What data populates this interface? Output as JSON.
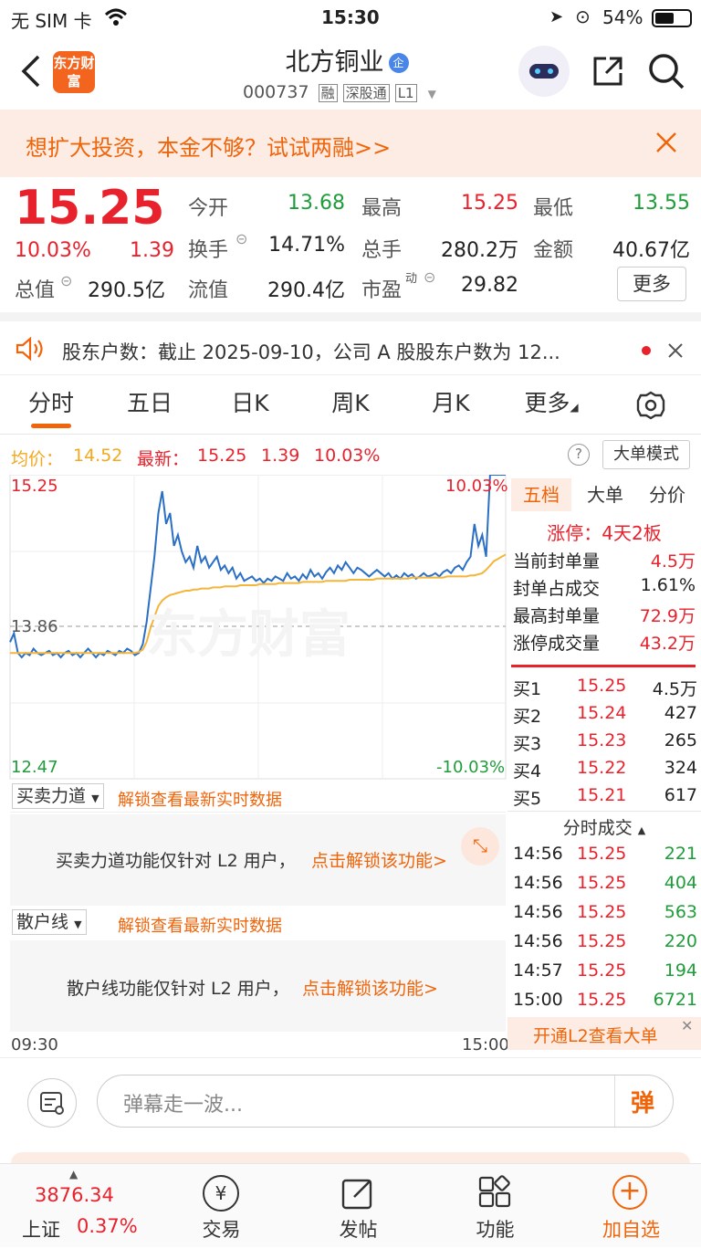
{
  "status": {
    "carrier": "无 SIM 卡",
    "time": "15:30",
    "battery": "54%"
  },
  "nav": {
    "title": "北方铜业",
    "badge": "企",
    "code": "000737",
    "tags": [
      "融",
      "深股通",
      "L1"
    ],
    "brand": "东方财富"
  },
  "promo": {
    "text": "想扩大投资，本金不够？试试两融>>"
  },
  "quote": {
    "price": "15.25",
    "change_pct": "10.03%",
    "change": "1.39",
    "open_label": "今开",
    "open": "13.68",
    "high_label": "最高",
    "high": "15.25",
    "low_label": "最低",
    "low": "13.55",
    "turnover_label": "换手",
    "turnover": "14.71%",
    "volume_label": "总手",
    "volume": "280.2万",
    "amount_label": "金额",
    "amount": "40.67亿",
    "mktcap_label": "总值",
    "mktcap": "290.5亿",
    "float_label": "流值",
    "float": "290.4亿",
    "pe_label": "市盈",
    "pe_sup": "动",
    "pe": "29.82",
    "more": "更多"
  },
  "notice": {
    "text": "股东户数：截止 2025-09-10，公司 A 股股东户数为 12..."
  },
  "tabs": [
    "分时",
    "五日",
    "日K",
    "周K",
    "月K",
    "更多"
  ],
  "legend": {
    "avg_label": "均价：",
    "avg": "14.52",
    "last_label": "最新：",
    "last": "15.25",
    "chg": "1.39",
    "pct": "10.03%",
    "bigorder": "大单模式"
  },
  "chart": {
    "y_top": "15.25",
    "y_mid": "13.86",
    "y_bot": "12.47",
    "pct_top": "10.03%",
    "pct_bot": "-10.03%",
    "watermark": "东方财富",
    "x_start": "09:30",
    "x_end": "15:00",
    "panel1_label": "买卖力道",
    "panel1_unlock": "解锁查看最新实时数据",
    "panel1_msg": "买卖力道功能仅针对 L2 用户，",
    "panel1_link": "点击解锁该功能>",
    "panel2_label": "散户线",
    "panel2_unlock": "解锁查看最新实时数据",
    "panel2_msg": "散户线功能仅针对 L2 用户，",
    "panel2_link": "点击解锁该功能>"
  },
  "chart_data": {
    "type": "line",
    "ylim": [
      12.47,
      15.25
    ],
    "prev_close": 13.86,
    "series": [
      {
        "name": "",
        "color": "#2a6fc4",
        "values": [
          13.72,
          13.8,
          13.62,
          13.58,
          13.62,
          13.6,
          13.66,
          13.62,
          13.6,
          13.62,
          13.64,
          13.6,
          13.62,
          13.58,
          13.62,
          13.64,
          13.6,
          13.62,
          13.58,
          13.62,
          13.66,
          13.62,
          13.58,
          13.62,
          13.6,
          13.64,
          13.62,
          13.6,
          13.64,
          13.62,
          13.66,
          13.64,
          13.6,
          13.62,
          13.7,
          13.9,
          14.2,
          14.5,
          14.9,
          15.1,
          14.8,
          14.9,
          14.6,
          14.7,
          14.55,
          14.45,
          14.5,
          14.4,
          14.6,
          14.45,
          14.5,
          14.4,
          14.45,
          14.5,
          14.38,
          14.42,
          14.35,
          14.4,
          14.3,
          14.35,
          14.28,
          14.3,
          14.32,
          14.28,
          14.3,
          14.26,
          14.3,
          14.28,
          14.32,
          14.3,
          14.28,
          14.35,
          14.3,
          14.32,
          14.28,
          14.34,
          14.3,
          14.38,
          14.32,
          14.35,
          14.3,
          14.36,
          14.4,
          14.35,
          14.42,
          14.38,
          14.45,
          14.4,
          14.35,
          14.4,
          14.38,
          14.35,
          14.32,
          14.35,
          14.38,
          14.35,
          14.32,
          14.35,
          14.3,
          14.33,
          14.3,
          14.35,
          14.32,
          14.34,
          14.3,
          14.32,
          14.35,
          14.32,
          14.33,
          14.35,
          14.32,
          14.36,
          14.38,
          14.35,
          14.4,
          14.42,
          14.38,
          14.45,
          14.5,
          14.8,
          14.6,
          14.7,
          14.5,
          15.25,
          15.25,
          15.25,
          15.25,
          15.25
        ]
      },
      {
        "name": "",
        "color": "#f3b53a",
        "values": [
          13.62,
          13.62,
          13.62,
          13.62,
          13.62,
          13.62,
          13.62,
          13.62,
          13.62,
          13.62,
          13.62,
          13.62,
          13.62,
          13.62,
          13.62,
          13.62,
          13.62,
          13.62,
          13.62,
          13.62,
          13.62,
          13.62,
          13.62,
          13.62,
          13.62,
          13.62,
          13.62,
          13.62,
          13.62,
          13.62,
          13.62,
          13.62,
          13.62,
          13.63,
          13.65,
          13.72,
          13.85,
          13.95,
          14.05,
          14.1,
          14.13,
          14.15,
          14.16,
          14.17,
          14.18,
          14.19,
          14.19,
          14.2,
          14.2,
          14.21,
          14.21,
          14.21,
          14.22,
          14.22,
          14.22,
          14.23,
          14.23,
          14.23,
          14.23,
          14.24,
          14.24,
          14.24,
          14.24,
          14.24,
          14.25,
          14.25,
          14.25,
          14.25,
          14.25,
          14.26,
          14.26,
          14.26,
          14.26,
          14.26,
          14.26,
          14.27,
          14.27,
          14.27,
          14.27,
          14.27,
          14.27,
          14.28,
          14.28,
          14.28,
          14.28,
          14.28,
          14.28,
          14.29,
          14.29,
          14.29,
          14.29,
          14.29,
          14.29,
          14.29,
          14.3,
          14.3,
          14.3,
          14.3,
          14.3,
          14.3,
          14.3,
          14.3,
          14.3,
          14.31,
          14.31,
          14.31,
          14.31,
          14.31,
          14.31,
          14.31,
          14.31,
          14.31,
          14.32,
          14.32,
          14.32,
          14.32,
          14.32,
          14.32,
          14.33,
          14.33,
          14.34,
          14.35,
          14.38,
          14.42,
          14.46,
          14.48,
          14.5,
          14.52
        ]
      }
    ],
    "xlabel": "",
    "ylabel": "",
    "grid": true
  },
  "panel": {
    "tabs": [
      "五档",
      "大单",
      "分价"
    ],
    "limit": "涨停：4天2板",
    "stats": [
      {
        "label": "当前封单量",
        "value": "4.5万"
      },
      {
        "label": "封单占成交",
        "value": "1.61%"
      },
      {
        "label": "最高封单量",
        "value": "72.9万"
      },
      {
        "label": "涨停成交量",
        "value": "43.2万"
      }
    ],
    "bids": [
      {
        "label": "买1",
        "price": "15.25",
        "vol": "4.5万"
      },
      {
        "label": "买2",
        "price": "15.24",
        "vol": "427"
      },
      {
        "label": "买3",
        "price": "15.23",
        "vol": "265"
      },
      {
        "label": "买4",
        "price": "15.22",
        "vol": "324"
      },
      {
        "label": "买5",
        "price": "15.21",
        "vol": "617"
      }
    ],
    "trades_title": "分时成交",
    "trades": [
      {
        "time": "14:56",
        "price": "15.25",
        "vol": "221"
      },
      {
        "time": "14:56",
        "price": "15.25",
        "vol": "404"
      },
      {
        "time": "14:56",
        "price": "15.25",
        "vol": "563"
      },
      {
        "time": "14:56",
        "price": "15.25",
        "vol": "220"
      },
      {
        "time": "14:57",
        "price": "15.25",
        "vol": "194"
      },
      {
        "time": "15:00",
        "price": "15.25",
        "vol": "6721"
      }
    ],
    "l2_promo": "开通L2查看大单"
  },
  "comment": {
    "placeholder": "弹幕走一波...",
    "danmu": "弹"
  },
  "bottom": {
    "index_value": "3876.34",
    "index_name": "上证",
    "index_pct": "0.37%",
    "items": [
      "交易",
      "发帖",
      "功能",
      "加自选"
    ]
  }
}
